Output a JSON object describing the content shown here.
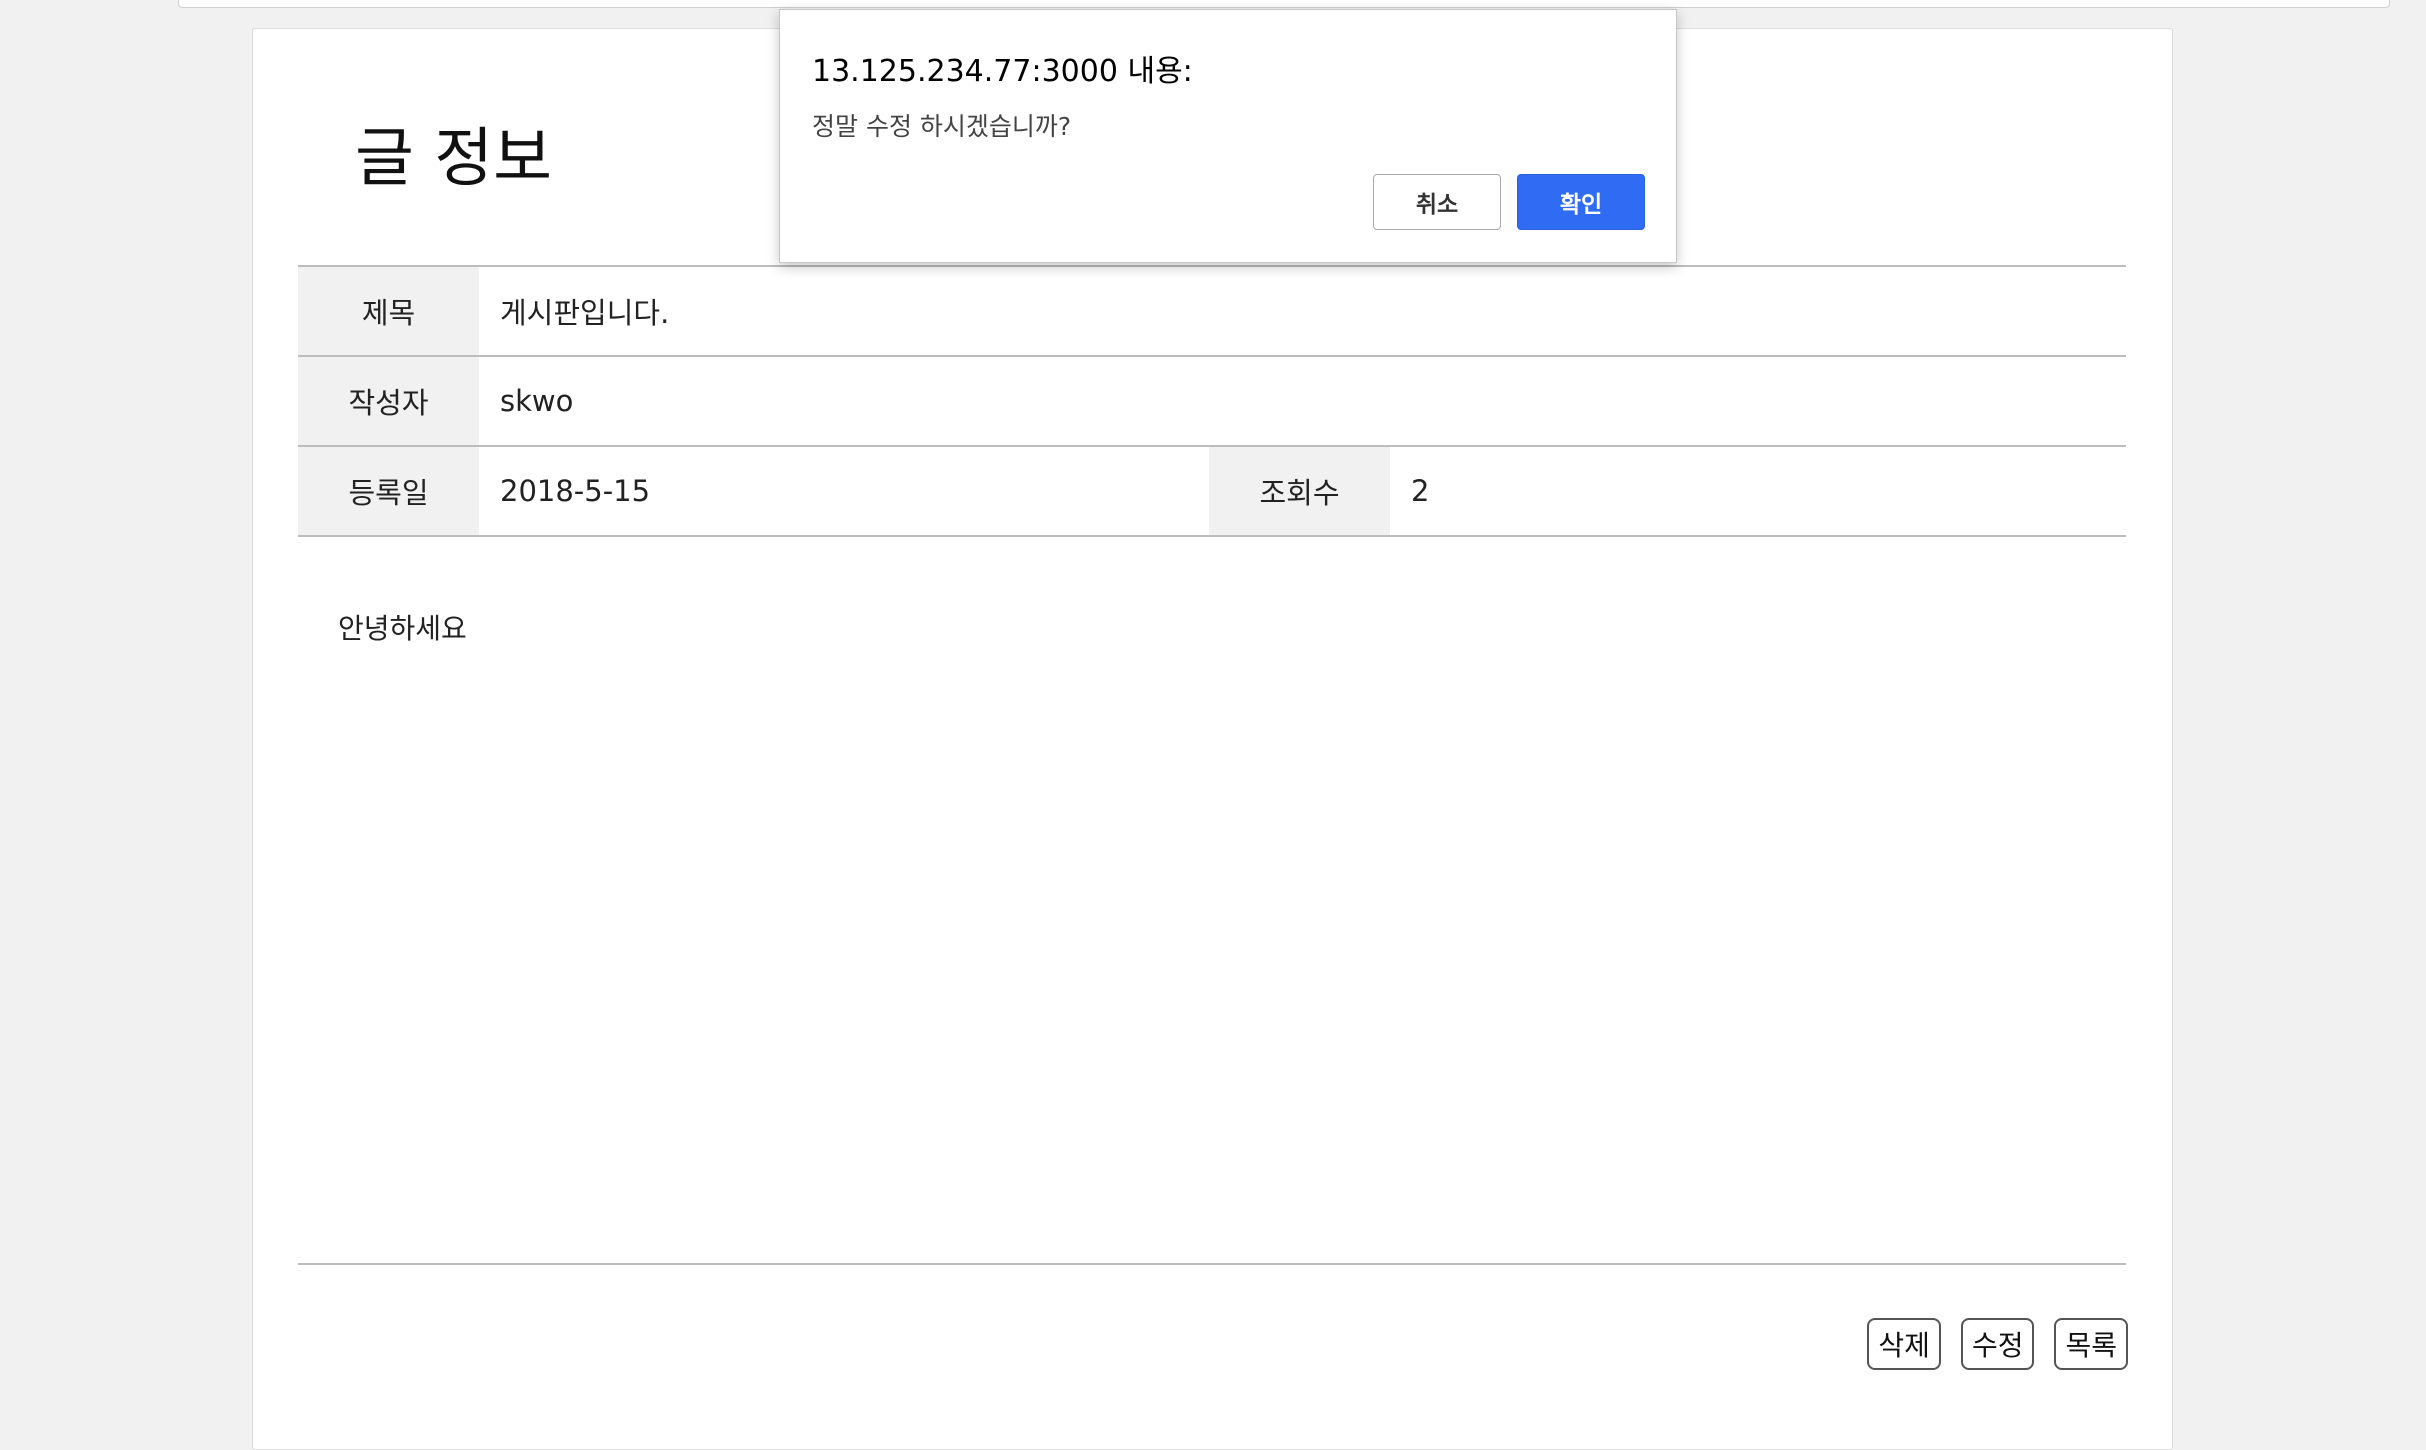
{
  "page": {
    "title": "글 정보"
  },
  "post": {
    "subject_label": "제목",
    "subject_value": "게시판입니다.",
    "author_label": "작성자",
    "author_value": "skwo",
    "date_label": "등록일",
    "date_value": "2018-5-15",
    "views_label": "조회수",
    "views_value": "2",
    "content": "안녕하세요"
  },
  "actions": {
    "delete_label": "삭제",
    "edit_label": "수정",
    "list_label": "목록"
  },
  "dialog": {
    "title": "13.125.234.77:3000 내용:",
    "message": "정말 수정 하시겠습니까?",
    "cancel_label": "취소",
    "confirm_label": "확인"
  },
  "colors": {
    "accent": "#2f6cf3",
    "header_cell_bg": "#f1f1f1",
    "border": "#bdbdbd"
  }
}
